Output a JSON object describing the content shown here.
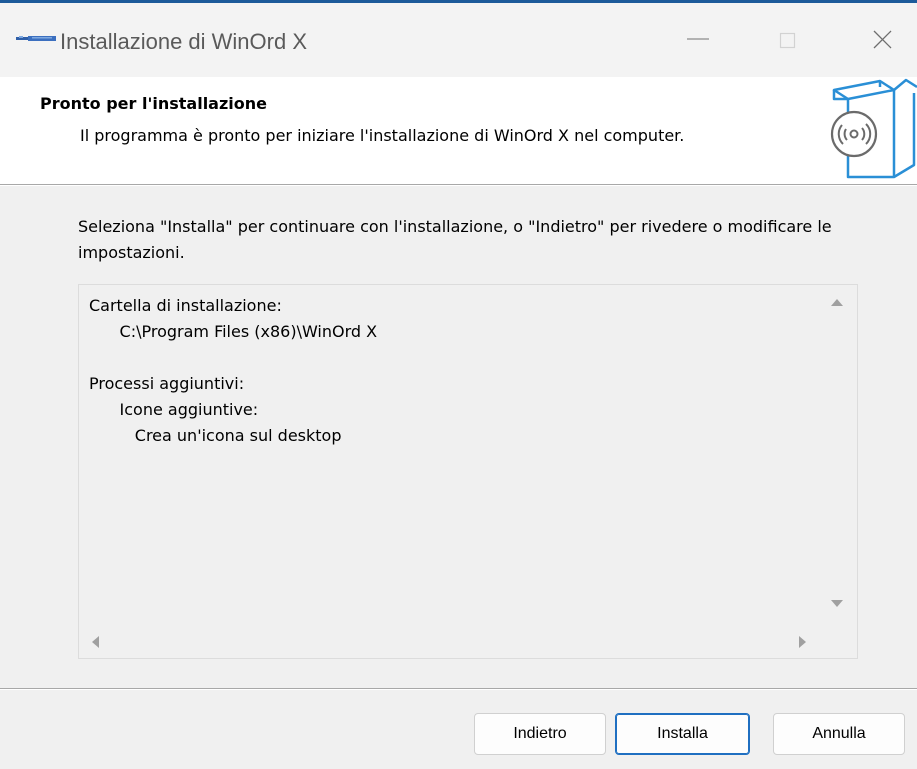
{
  "window": {
    "title": "Installazione di WinOrd X",
    "controls": {
      "minimize": "minimize-icon",
      "maximize": "maximize-icon",
      "close": "close-icon"
    }
  },
  "header": {
    "title": "Pronto per l'installazione",
    "subtitle": "Il programma è pronto per iniziare l'installazione di WinOrd X nel computer."
  },
  "body": {
    "instructions": "Seleziona \"Installa\" per continuare con l'installazione, o \"Indietro\" per rivedere o modificare le impostazioni.",
    "memo": [
      "Cartella di installazione:",
      "      C:\\Program Files (x86)\\WinOrd X",
      "",
      "Processi aggiuntivi:",
      "      Icone aggiuntive:",
      "         Crea un'icona sul desktop"
    ]
  },
  "buttons": {
    "back": "Indietro",
    "install": "Installa",
    "cancel": "Annulla"
  },
  "colors": {
    "accent": "#1f6fc1",
    "icon_blue": "#2a8fd6"
  }
}
